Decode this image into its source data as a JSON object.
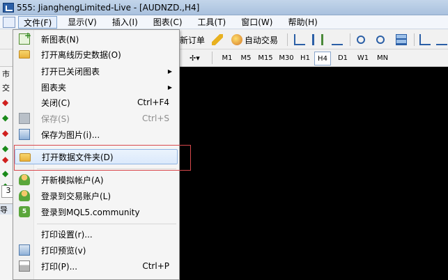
{
  "window": {
    "title": "555: JianghengLimited-Live - [AUDNZD.,H4]"
  },
  "menubar": {
    "items": [
      {
        "label": "文件(F)",
        "active": true
      },
      {
        "label": "显示(V)"
      },
      {
        "label": "插入(I)"
      },
      {
        "label": "图表(C)"
      },
      {
        "label": "工具(T)"
      },
      {
        "label": "窗口(W)"
      },
      {
        "label": "帮助(H)"
      }
    ]
  },
  "toolbar": {
    "new_order": "新订单",
    "auto_trade": "自动交易"
  },
  "timeframes": [
    "M1",
    "M5",
    "M15",
    "M30",
    "H1",
    "H4",
    "D1",
    "W1",
    "MN"
  ],
  "active_timeframe": "H4",
  "left_panel": {
    "market_watch_label": "市",
    "tab_label": "交",
    "navigator_label": "导",
    "bottom_tab": "3"
  },
  "file_menu": {
    "items": [
      {
        "label": "新图表(N)",
        "shortcut": "",
        "icon": "new-chart-icon"
      },
      {
        "label": "打开离线历史数据(O)",
        "shortcut": "",
        "icon": "open-folder-icon"
      },
      {
        "label": "打开已关闭图表",
        "shortcut": "",
        "submenu": true
      },
      {
        "label": "图表夹",
        "shortcut": "",
        "submenu": true
      },
      {
        "label": "关闭(C)",
        "shortcut": "Ctrl+F4"
      },
      {
        "label": "保存(S)",
        "shortcut": "Ctrl+S",
        "disabled": true,
        "icon": "save-icon"
      },
      {
        "label": "保存为图片(i)...",
        "shortcut": "",
        "icon": "save-image-icon"
      },
      {
        "label": "打开数据文件夹(D)",
        "shortcut": "",
        "icon": "data-folder-icon",
        "highlighted": true
      },
      {
        "label": "开新模拟帐户(A)",
        "shortcut": "",
        "icon": "new-demo-account-icon"
      },
      {
        "label": "登录到交易账户(L)",
        "shortcut": "",
        "icon": "login-account-icon"
      },
      {
        "label": "登录到MQL5.community",
        "shortcut": "",
        "icon": "mql5-icon"
      },
      {
        "label": "打印设置(r)...",
        "shortcut": ""
      },
      {
        "label": "打印预览(v)",
        "shortcut": "",
        "icon": "print-preview-icon"
      },
      {
        "label": "打印(P)...",
        "shortcut": "Ctrl+P",
        "icon": "print-icon"
      }
    ]
  },
  "colors": {
    "annotation": "#d8484c",
    "chart_background": "#000000",
    "highlight": "#dbe9fb"
  }
}
